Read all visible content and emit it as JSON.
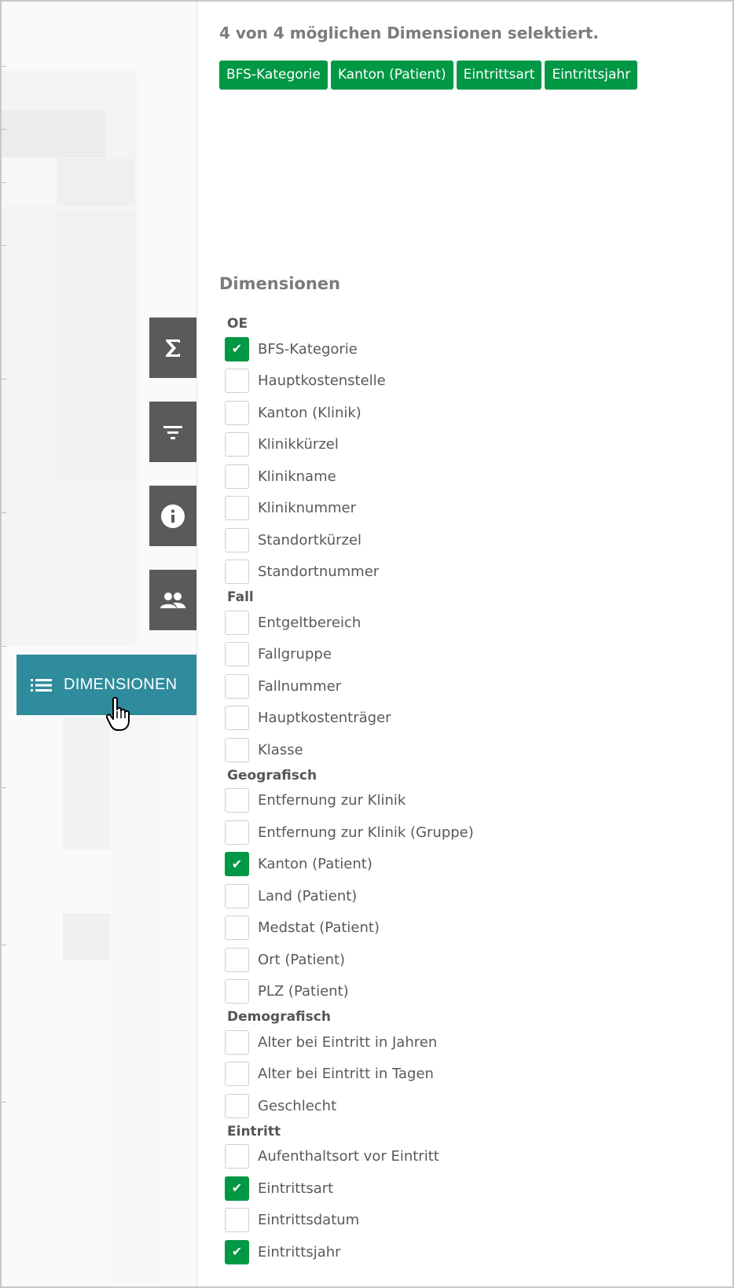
{
  "summary": "4 von 4 möglichen Dimensionen selektiert.",
  "selected_chips": [
    "BFS-Kategorie",
    "Kanton (Patient)",
    "Eintrittsart",
    "Eintrittsjahr"
  ],
  "section_title": "Dimensionen",
  "sidebar_button": {
    "label": "DIMENSIONEN"
  },
  "tool_buttons": [
    "sigma-icon",
    "filter-icon",
    "info-icon",
    "people-icon"
  ],
  "accent_green": "#009845",
  "accent_teal": "#2e8c9c",
  "groups": [
    {
      "title": "OE",
      "items": [
        {
          "label": "BFS-Kategorie",
          "checked": true
        },
        {
          "label": "Hauptkostenstelle",
          "checked": false
        },
        {
          "label": "Kanton (Klinik)",
          "checked": false
        },
        {
          "label": "Klinikkürzel",
          "checked": false
        },
        {
          "label": "Klinikname",
          "checked": false
        },
        {
          "label": "Kliniknummer",
          "checked": false
        },
        {
          "label": "Standortkürzel",
          "checked": false
        },
        {
          "label": "Standortnummer",
          "checked": false
        }
      ]
    },
    {
      "title": "Fall",
      "items": [
        {
          "label": "Entgeltbereich",
          "checked": false
        },
        {
          "label": "Fallgruppe",
          "checked": false
        },
        {
          "label": "Fallnummer",
          "checked": false
        },
        {
          "label": "Hauptkostenträger",
          "checked": false
        },
        {
          "label": "Klasse",
          "checked": false
        }
      ]
    },
    {
      "title": "Geografisch",
      "items": [
        {
          "label": "Entfernung zur Klinik",
          "checked": false
        },
        {
          "label": "Entfernung zur Klinik (Gruppe)",
          "checked": false
        },
        {
          "label": "Kanton (Patient)",
          "checked": true
        },
        {
          "label": "Land (Patient)",
          "checked": false
        },
        {
          "label": "Medstat (Patient)",
          "checked": false
        },
        {
          "label": "Ort (Patient)",
          "checked": false
        },
        {
          "label": "PLZ (Patient)",
          "checked": false
        }
      ]
    },
    {
      "title": "Demografisch",
      "items": [
        {
          "label": "Alter bei Eintritt in Jahren",
          "checked": false
        },
        {
          "label": "Alter bei Eintritt in Tagen",
          "checked": false
        },
        {
          "label": "Geschlecht",
          "checked": false
        }
      ]
    },
    {
      "title": "Eintritt",
      "items": [
        {
          "label": "Aufenthaltsort vor Eintritt",
          "checked": false
        },
        {
          "label": "Eintrittsart",
          "checked": true
        },
        {
          "label": "Eintrittsdatum",
          "checked": false
        },
        {
          "label": "Eintrittsjahr",
          "checked": true
        }
      ]
    }
  ]
}
